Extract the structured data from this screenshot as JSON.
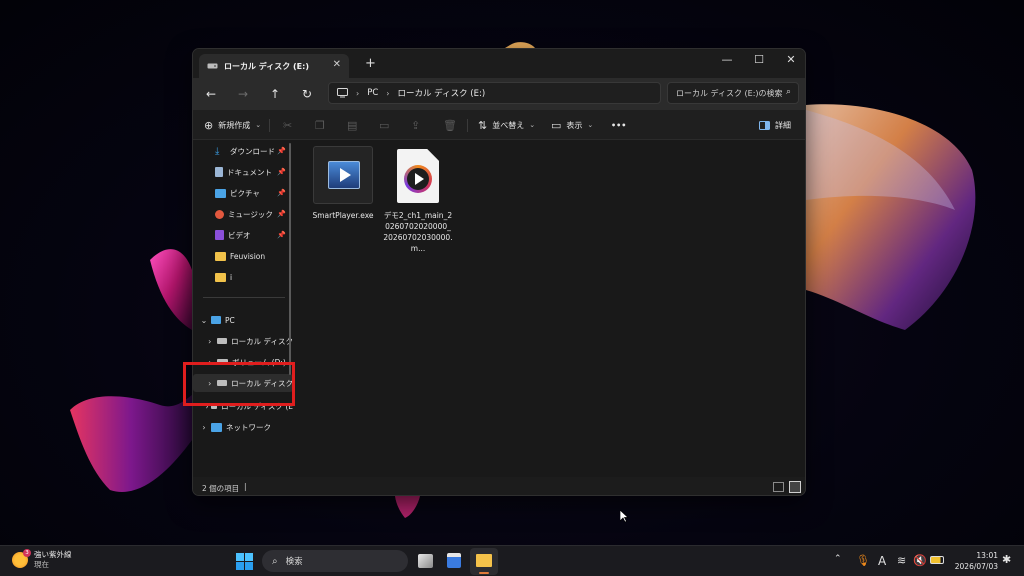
{
  "window": {
    "tab_title": "ローカル ディスク (E:)",
    "new_tab_symbol": "+",
    "controls": {
      "minimize": "—",
      "maximize": "☐",
      "close": "✕"
    }
  },
  "nav": {
    "back_icon": "arrow-left-icon",
    "forward_icon": "arrow-right-icon",
    "up_icon": "arrow-up-icon",
    "refresh_icon": "refresh-icon",
    "breadcrumb": [
      "PC",
      "ローカル ディスク (E:)"
    ],
    "search_placeholder": "ローカル ディスク (E:)の検索"
  },
  "commands": {
    "new": "新規作成",
    "sort": "並べ替え",
    "view": "表示",
    "more": "•••",
    "details": "詳細"
  },
  "sidebar": {
    "quick": [
      {
        "label": "ダウンロード",
        "icon": "download-icon",
        "color": "#3aa0e8",
        "pinned": true
      },
      {
        "label": "ドキュメント",
        "icon": "document-icon",
        "color": "#9bb6d6",
        "pinned": true
      },
      {
        "label": "ピクチャ",
        "icon": "pictures-icon",
        "color": "#4aa3e6",
        "pinned": true
      },
      {
        "label": "ミュージック",
        "icon": "music-icon",
        "color": "#e2583e",
        "pinned": true
      },
      {
        "label": "ビデオ",
        "icon": "video-icon",
        "color": "#8a4fd9",
        "pinned": true
      },
      {
        "label": "Feuvision",
        "icon": "folder-icon",
        "color": "#f1c24a",
        "pinned": false
      },
      {
        "label": "i",
        "icon": "folder-icon",
        "color": "#f1c24a",
        "pinned": false
      }
    ],
    "tree": [
      {
        "label": "PC",
        "icon": "pc-icon"
      },
      {
        "label": "ローカル ディスク",
        "icon": "drive-icon"
      },
      {
        "label": "ボリューム (D:)",
        "icon": "drive-icon"
      },
      {
        "label": "ローカル ディスク",
        "icon": "drive-icon"
      },
      {
        "label": "ローカル ディスク (E",
        "icon": "drive-icon"
      },
      {
        "label": "ネットワーク",
        "icon": "network-icon"
      }
    ]
  },
  "files": [
    {
      "name": "SmartPlayer.exe",
      "icon": "video-player-icon"
    },
    {
      "name": "デモ2_ch1_main_20260702020000_20260702030000.m...",
      "icon": "media-file-icon"
    }
  ],
  "status": {
    "item_count": "2 個の項目",
    "cursor_bar": "|"
  },
  "taskbar": {
    "weather_title": "強い紫外線",
    "weather_sub": "現在",
    "weather_badge": "3",
    "search_label": "検索",
    "time": "13:01",
    "date": "2026/07/03",
    "ime": "A"
  }
}
